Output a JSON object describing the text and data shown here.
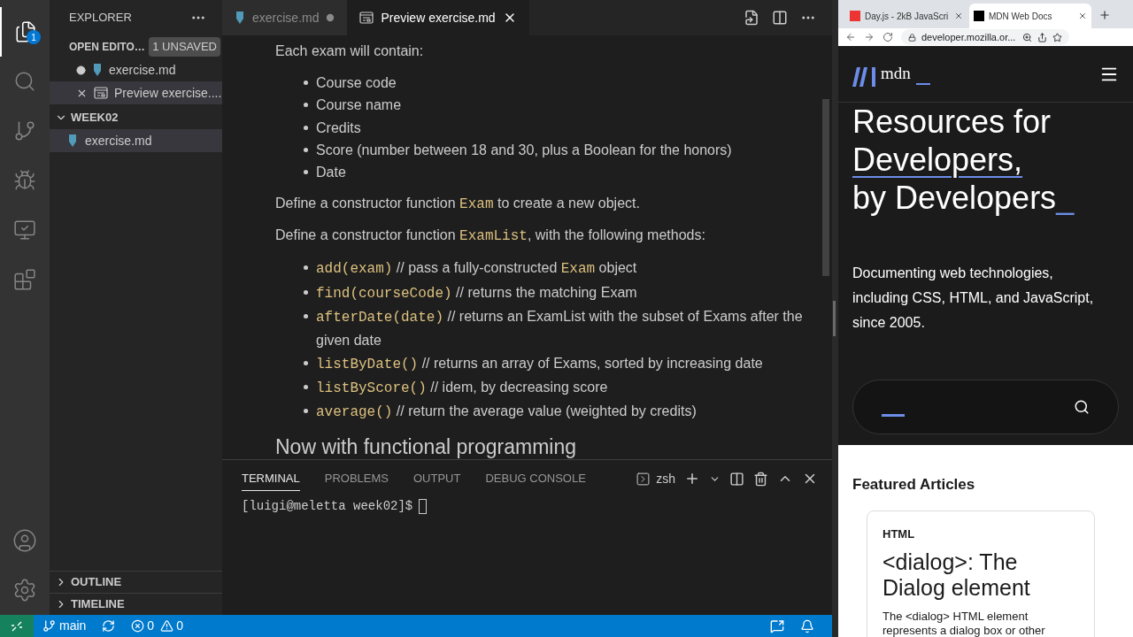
{
  "activity_bar": {
    "explorer_badge": "1",
    "items": [
      {
        "kind": "explorer",
        "selected": true
      },
      {
        "kind": "search",
        "selected": false
      },
      {
        "kind": "git",
        "selected": false
      },
      {
        "kind": "debug",
        "selected": false
      },
      {
        "kind": "remote",
        "selected": false
      },
      {
        "kind": "extensions",
        "selected": false
      }
    ]
  },
  "sidebar": {
    "title": "EXPLORER",
    "open_editors": {
      "title": "OPEN EDITO…",
      "badge": "1 UNSAVED",
      "items": [
        {
          "name": "exercise.md",
          "kind": "markdown",
          "dirty": true,
          "selected": false
        },
        {
          "name": "Preview exercise....",
          "kind": "preview",
          "dirty": false,
          "selected": true
        }
      ]
    },
    "folder": {
      "name": "WEEK02",
      "expanded": true,
      "files": [
        {
          "name": "exercise.md",
          "selected": true
        }
      ]
    },
    "sections": [
      {
        "name": "OUTLINE",
        "expanded": false
      },
      {
        "name": "TIMELINE",
        "expanded": false
      }
    ]
  },
  "tabs": [
    {
      "label": "exercise.md",
      "kind": "markdown",
      "selected": false,
      "dirty": true
    },
    {
      "label": "Preview exercise.md",
      "kind": "preview",
      "selected": true,
      "dirty": false
    }
  ],
  "preview": [
    {
      "kind": "paragraph",
      "parts": [
        {
          "text": "Each exam will contain:"
        }
      ]
    },
    {
      "kind": "list",
      "items": [
        [
          {
            "text": "Course code"
          }
        ],
        [
          {
            "text": "Course name"
          }
        ],
        [
          {
            "text": "Credits"
          }
        ],
        [
          {
            "text": "Score (number between 18 and 30, plus a Boolean for the honors)"
          }
        ],
        [
          {
            "text": "Date"
          }
        ]
      ]
    },
    {
      "kind": "paragraph",
      "parts": [
        {
          "text": "Define a constructor function "
        },
        {
          "code": true,
          "text": "Exam"
        },
        {
          "text": " to create a new object."
        }
      ]
    },
    {
      "kind": "paragraph",
      "parts": [
        {
          "text": "Define a constructor function "
        },
        {
          "code": true,
          "text": "ExamList"
        },
        {
          "text": ", with the following methods:"
        }
      ]
    },
    {
      "kind": "list",
      "items": [
        [
          {
            "code": true,
            "text": "add(exam)"
          },
          {
            "text": " // pass a fully-constructed "
          },
          {
            "code": true,
            "text": "Exam"
          },
          {
            "text": " object"
          }
        ],
        [
          {
            "code": true,
            "text": "find(courseCode)"
          },
          {
            "text": " // returns the matching Exam"
          }
        ],
        [
          {
            "code": true,
            "text": "afterDate(date)"
          },
          {
            "text": " // returns an ExamList with the subset of Exams after the given date"
          }
        ],
        [
          {
            "code": true,
            "text": "listByDate()"
          },
          {
            "text": " // returns an array of Exams, sorted by increasing date"
          }
        ],
        [
          {
            "code": true,
            "text": "listByScore()"
          },
          {
            "text": " // idem, by decreasing score"
          }
        ],
        [
          {
            "code": true,
            "text": "average()"
          },
          {
            "text": " // return the average value (weighted by credits)"
          }
        ]
      ]
    },
    {
      "kind": "heading",
      "parts": [
        {
          "text": "Now with functional programming"
        }
      ]
    }
  ],
  "panel": {
    "tabs": [
      {
        "label": "TERMINAL",
        "selected": true
      },
      {
        "label": "PROBLEMS",
        "selected": false
      },
      {
        "label": "OUTPUT",
        "selected": false
      },
      {
        "label": "DEBUG CONSOLE",
        "selected": false
      }
    ],
    "shell": "zsh",
    "prompt": "[luigi@meletta week02]$"
  },
  "status_bar": {
    "branch": "main",
    "errors": "0",
    "warnings": "0"
  },
  "browser": {
    "tabs": [
      {
        "title": "Day.js - 2kB JavaScri",
        "selected": false
      },
      {
        "title": "MDN Web Docs",
        "selected": true
      }
    ],
    "url": "developer.mozilla.or...",
    "logo": "mdn",
    "hero": [
      "Resources for",
      "Developers,",
      "by Developers"
    ],
    "hero_cursor": "_",
    "description": "Documenting web technologies, including CSS, HTML, and JavaScript, since 2005.",
    "featured_title": "Featured Articles",
    "card": {
      "tag": "HTML",
      "title": "<dialog>: The Dialog element",
      "text": "The <dialog> HTML element represents a dialog box or other"
    }
  }
}
